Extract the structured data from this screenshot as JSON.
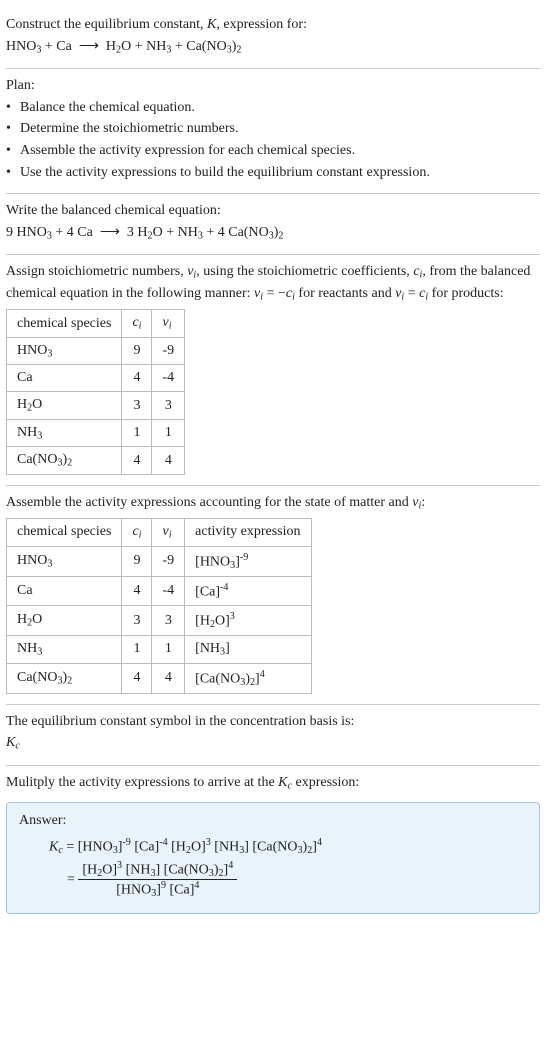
{
  "header": {
    "title": "Construct the equilibrium constant, K, expression for:",
    "equation": "HNO₃ + Ca  ⟶  H₂O + NH₃ + Ca(NO₃)₂"
  },
  "plan": {
    "title": "Plan:",
    "items": [
      "Balance the chemical equation.",
      "Determine the stoichiometric numbers.",
      "Assemble the activity expression for each chemical species.",
      "Use the activity expressions to build the equilibrium constant expression."
    ]
  },
  "balanced": {
    "title": "Write the balanced chemical equation:",
    "equation": "9 HNO₃ + 4 Ca  ⟶  3 H₂O + NH₃ + 4 Ca(NO₃)₂"
  },
  "stoich": {
    "intro1": "Assign stoichiometric numbers, νᵢ, using the stoichiometric coefficients, cᵢ, from",
    "intro2": "the balanced chemical equation in the following manner: νᵢ = −cᵢ for reactants",
    "intro3": "and νᵢ = cᵢ for products:",
    "head_species": "chemical species",
    "head_c": "cᵢ",
    "head_v": "νᵢ",
    "rows": [
      {
        "s": "HNO₃",
        "c": "9",
        "v": "-9"
      },
      {
        "s": "Ca",
        "c": "4",
        "v": "-4"
      },
      {
        "s": "H₂O",
        "c": "3",
        "v": "3"
      },
      {
        "s": "NH₃",
        "c": "1",
        "v": "1"
      },
      {
        "s": "Ca(NO₃)₂",
        "c": "4",
        "v": "4"
      }
    ]
  },
  "activity": {
    "intro": "Assemble the activity expressions accounting for the state of matter and νᵢ:",
    "head_species": "chemical species",
    "head_c": "cᵢ",
    "head_v": "νᵢ",
    "head_act": "activity expression",
    "rows": [
      {
        "s": "HNO₃",
        "c": "9",
        "v": "-9",
        "a": "[HNO₃]⁻⁹"
      },
      {
        "s": "Ca",
        "c": "4",
        "v": "-4",
        "a": "[Ca]⁻⁴"
      },
      {
        "s": "H₂O",
        "c": "3",
        "v": "3",
        "a": "[H₂O]³"
      },
      {
        "s": "NH₃",
        "c": "1",
        "v": "1",
        "a": "[NH₃]"
      },
      {
        "s": "Ca(NO₃)₂",
        "c": "4",
        "v": "4",
        "a": "[Ca(NO₃)₂]⁴"
      }
    ]
  },
  "eqconst": {
    "line1": "The equilibrium constant symbol in the concentration basis is:",
    "symbol": "K𝒸"
  },
  "multiply": {
    "line": "Mulitply the activity expressions to arrive at the K𝒸 expression:"
  },
  "answer": {
    "title": "Answer:",
    "lhs": "K𝒸 = ",
    "prod": "[HNO₃]⁻⁹ [Ca]⁻⁴ [H₂O]³ [NH₃] [Ca(NO₃)₂]⁴",
    "eq2": " = ",
    "num": "[H₂O]³ [NH₃] [Ca(NO₃)₂]⁴",
    "den": "[HNO₃]⁹ [Ca]⁴"
  }
}
